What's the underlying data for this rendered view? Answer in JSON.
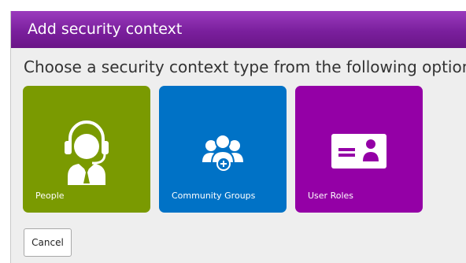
{
  "dialog": {
    "title": "Add security context",
    "instructions": "Choose a security context type from the following options.",
    "tiles": [
      {
        "label": "People",
        "icon": "person-headset-icon",
        "color": "#7a9a01"
      },
      {
        "label": "Community Groups",
        "icon": "people-group-add-icon",
        "color": "#0072c6"
      },
      {
        "label": "User Roles",
        "icon": "id-card-icon",
        "color": "#9400a6"
      }
    ],
    "cancel_label": "Cancel"
  },
  "colors": {
    "title_bar": "#7a1f9d",
    "background": "#eeeeee"
  }
}
